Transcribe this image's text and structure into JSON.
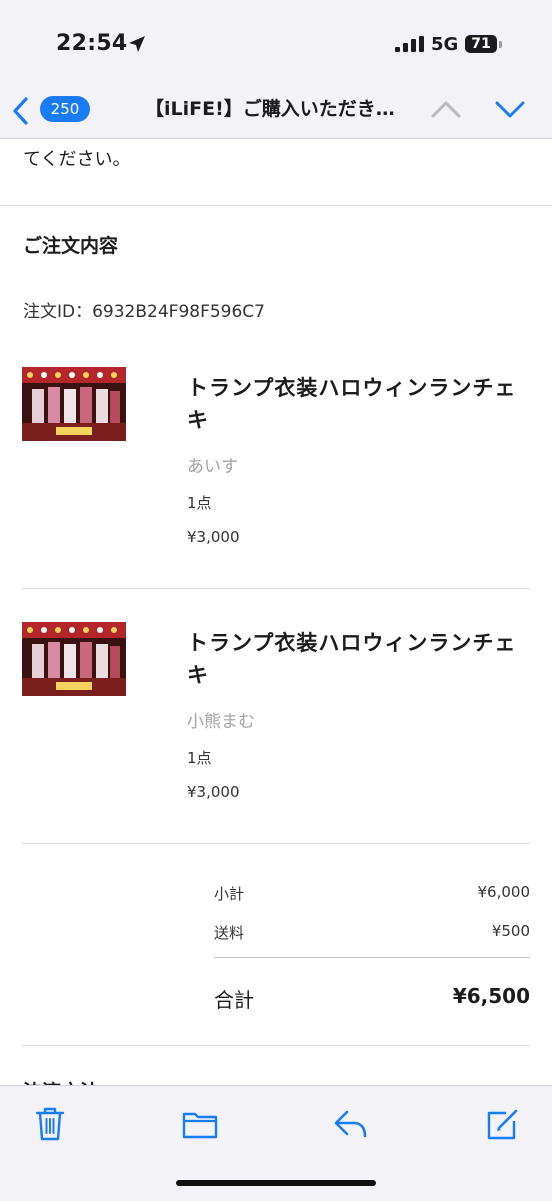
{
  "status": {
    "time": "22:54",
    "network": "5G",
    "battery": "71",
    "icons": [
      "location-arrow-icon",
      "signal-bars-icon"
    ]
  },
  "nav": {
    "unread_count": "250",
    "subject": "【iLiFE!】ご購入いただき…",
    "icons": [
      "back-chevron-icon",
      "up-chevron-icon",
      "down-chevron-icon"
    ]
  },
  "email": {
    "intro_text": "てください。",
    "section_heading": "ご注文内容",
    "order_id": "注文ID：6932B24F98F596C7",
    "items": [
      {
        "title": "トランプ衣装ハロウィンランチェキ",
        "variant": "あいす",
        "quantity": "1点",
        "price": "¥3,000"
      },
      {
        "title": "トランプ衣装ハロウィンランチェキ",
        "variant": "小熊まむ",
        "quantity": "1点",
        "price": "¥3,000"
      }
    ],
    "summary": {
      "subtotal_label": "小計",
      "subtotal_value": "¥6,000",
      "shipping_label": "送料",
      "shipping_value": "¥500",
      "total_label": "合計",
      "total_value": "¥6,500"
    },
    "next_section_peek": "決済方法"
  },
  "toolbar": {
    "icons": [
      "trash-icon",
      "folder-icon",
      "reply-icon",
      "compose-icon"
    ]
  },
  "colors": {
    "accent": "#1a7cf5",
    "bar_background": "#f2f2f7",
    "muted_text": "#a3a3a8"
  }
}
